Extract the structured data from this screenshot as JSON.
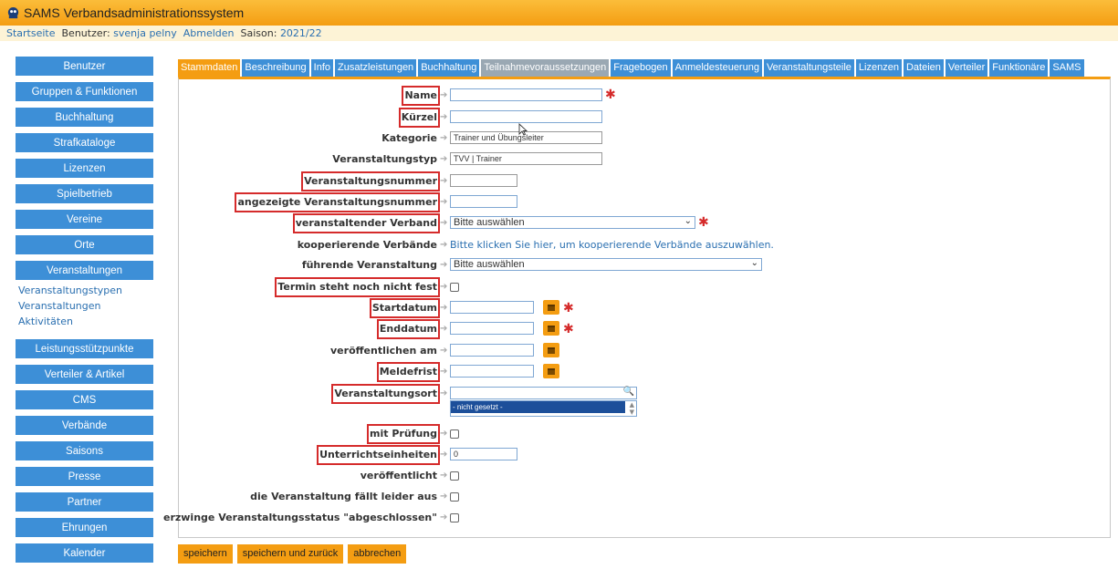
{
  "header": {
    "title": "SAMS Verbandsadministrationssystem",
    "start_link": "Startseite",
    "user_label": "Benutzer:",
    "user_name": "svenja pelny",
    "logout_link": "Abmelden",
    "season_label": "Saison:",
    "season_value": "2021/22"
  },
  "sidebar": {
    "items_top": [
      {
        "label": "Benutzer"
      },
      {
        "label": "Gruppen & Funktionen"
      },
      {
        "label": "Buchhaltung"
      },
      {
        "label": "Strafkataloge"
      },
      {
        "label": "Lizenzen"
      },
      {
        "label": "Spielbetrieb"
      },
      {
        "label": "Vereine"
      },
      {
        "label": "Orte"
      },
      {
        "label": "Veranstaltungen"
      }
    ],
    "subitems": [
      {
        "label": "Veranstaltungstypen"
      },
      {
        "label": "Veranstaltungen"
      },
      {
        "label": "Aktivitäten"
      }
    ],
    "items_bottom": [
      {
        "label": "Leistungsstützpunkte"
      },
      {
        "label": "Verteiler & Artikel"
      },
      {
        "label": "CMS"
      },
      {
        "label": "Verbände"
      },
      {
        "label": "Saisons"
      },
      {
        "label": "Presse"
      },
      {
        "label": "Partner"
      },
      {
        "label": "Ehrungen"
      },
      {
        "label": "Kalender"
      }
    ]
  },
  "tabs": [
    {
      "label": "Stammdaten",
      "state": "active"
    },
    {
      "label": "Beschreibung",
      "state": "normal"
    },
    {
      "label": "Info",
      "state": "normal"
    },
    {
      "label": "Zusatzleistungen",
      "state": "normal"
    },
    {
      "label": "Buchhaltung",
      "state": "normal"
    },
    {
      "label": "Teilnahmevoraussetzungen",
      "state": "disabled"
    },
    {
      "label": "Fragebogen",
      "state": "normal"
    },
    {
      "label": "Anmeldesteuerung",
      "state": "normal"
    },
    {
      "label": "Veranstaltungsteile",
      "state": "normal"
    },
    {
      "label": "Lizenzen",
      "state": "normal"
    },
    {
      "label": "Dateien",
      "state": "normal"
    },
    {
      "label": "Verteiler",
      "state": "normal"
    },
    {
      "label": "Funktionäre",
      "state": "normal"
    },
    {
      "label": "SAMS",
      "state": "normal"
    }
  ],
  "form": {
    "name_label": "Name",
    "kuerzel_label": "Kürzel",
    "kategorie_label": "Kategorie",
    "kategorie_value": "Trainer und Übungsleiter",
    "typ_label": "Veranstaltungstyp",
    "typ_value": "TVV | Trainer",
    "nummer_label": "Veranstaltungsnummer",
    "angezeigte_nummer_label": "angezeigte Veranstaltungsnummer",
    "verband_label": "veranstaltender Verband",
    "verband_value": "Bitte auswählen",
    "kooperierend_label": "kooperierende Verbände",
    "kooperierend_link": "Bitte klicken Sie hier, um kooperierende Verbände auszuwählen.",
    "fuehrende_label": "führende Veranstaltung",
    "fuehrende_value": "Bitte auswählen",
    "termin_label": "Termin steht noch nicht fest",
    "start_label": "Startdatum",
    "end_label": "Enddatum",
    "veroeff_am_label": "veröffentlichen am",
    "meldefrist_label": "Meldefrist",
    "ort_label": "Veranstaltungsort",
    "ort_option": "- nicht gesetzt -",
    "pruefung_label": "mit Prüfung",
    "ue_label": "Unterrichtseinheiten",
    "ue_value": "0",
    "veroeff_label": "veröffentlicht",
    "faellt_aus_label": "die Veranstaltung fällt leider aus",
    "abgeschlossen_label": "erzwinge Veranstaltungsstatus \"abgeschlossen\""
  },
  "actions": {
    "save": "speichern",
    "save_back": "speichern und zurück",
    "cancel": "abbrechen"
  },
  "colors": {
    "accent_orange": "#f49d12",
    "nav_blue": "#3d8fd7",
    "highlight_red": "#d52b2b"
  }
}
